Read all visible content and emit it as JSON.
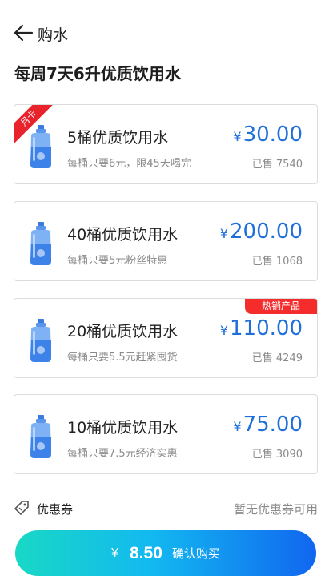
{
  "header": {
    "back_icon": "arrow-left-icon",
    "title": "购水"
  },
  "section_title": "每周7天6升优质饮用水",
  "currency_symbol": "¥",
  "products": [
    {
      "name": "5桶优质饮用水",
      "desc": "每桶只要6元，限45天喝完",
      "price": "30.00",
      "sold": "已售 7540",
      "ribbon": "月卡"
    },
    {
      "name": "40桶优质饮用水",
      "desc": "每桶只要5元粉丝特惠",
      "price": "200.00",
      "sold": "已售 1068"
    },
    {
      "name": "20桶优质饮用水",
      "desc": "每桶只要5.5元赶紧囤货",
      "price": "110.00",
      "sold": "已售 4249",
      "badge": "热销产品"
    },
    {
      "name": "10桶优质饮用水",
      "desc": "每桶只要7.5元经济实惠",
      "price": "75.00",
      "sold": "已售 3090"
    }
  ],
  "coupon": {
    "icon": "coupon-icon",
    "label": "优惠券",
    "status": "暂无优惠券可用"
  },
  "checkout": {
    "currency": "¥",
    "amount": "8.50",
    "label": "确认购买"
  },
  "colors": {
    "price": "#1f6fdb",
    "ribbon": "#e8232c",
    "badge": "#f52c2c",
    "button_gradient": [
      "#19d8c5",
      "#12b9f0",
      "#1166f0"
    ]
  }
}
